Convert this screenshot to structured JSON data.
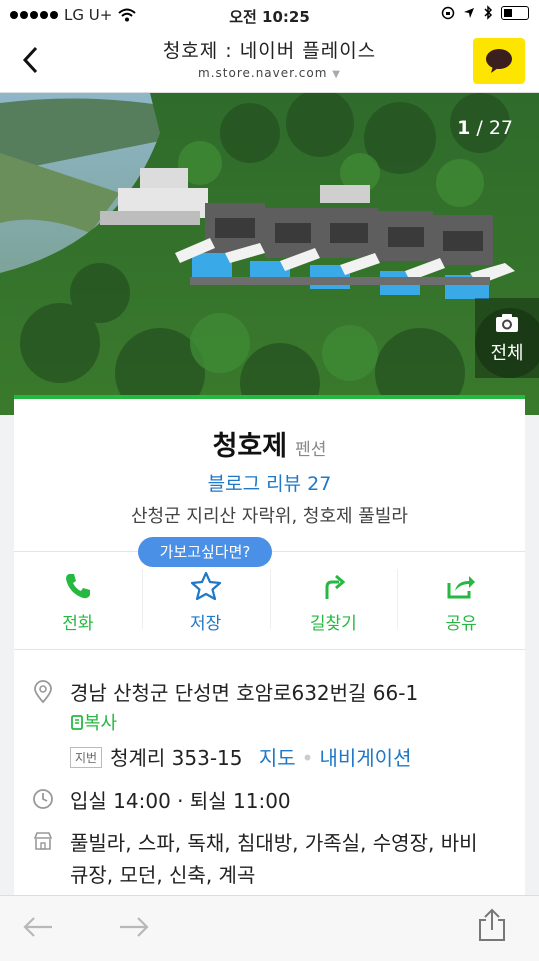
{
  "status": {
    "carrier": "LG U+",
    "time": "오전 10:25"
  },
  "navbar": {
    "title": "청호제 : 네이버 플레이스",
    "url": "m.store.naver.com"
  },
  "hero": {
    "current": "1",
    "total": "/ 27",
    "all_label": "전체"
  },
  "place": {
    "name": "청호제",
    "category": "펜션",
    "blog_review": "블로그 리뷰 27",
    "description": "산청군 지리산 자락위, 청호제 풀빌라"
  },
  "tooltip": "가보고싶다면?",
  "actions": [
    {
      "label": "전화",
      "icon": "phone-icon",
      "color": "#27b842"
    },
    {
      "label": "저장",
      "icon": "star-icon",
      "color": "#1f78c8"
    },
    {
      "label": "길찾기",
      "icon": "route-icon",
      "color": "#27b842"
    },
    {
      "label": "공유",
      "icon": "share-icon",
      "color": "#27b842"
    }
  ],
  "address": {
    "road": "경남 산청군 단성면 호암로632번길 66-1",
    "copy_label": "복사",
    "jibun_tag": "지번",
    "jibun": "청계리 353-15",
    "map_label": "지도",
    "navi_label": "내비게이션"
  },
  "hours": "입실 14:00 · 퇴실 11:00",
  "features_line1": "풀빌라, 스파, 독채, 침대방, 가족실, 수영장, 바비",
  "features_line2": "큐장, 모던, 신축, 계곡",
  "colors": {
    "accent": "#27b842",
    "link": "#1f78c8",
    "tooltip": "#4a90e6",
    "kakao": "#fee500"
  }
}
